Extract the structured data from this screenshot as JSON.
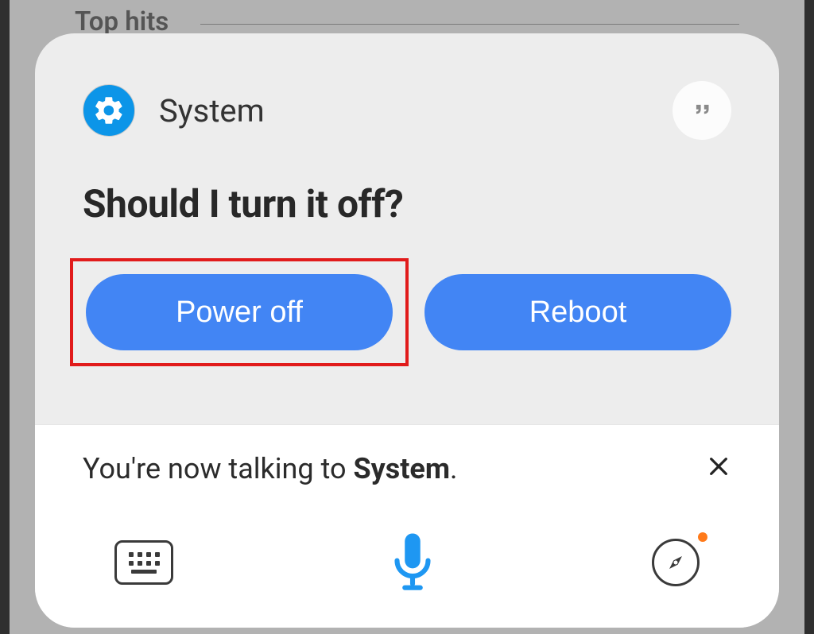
{
  "backgroundLabel": "Top hits",
  "header": {
    "systemLabel": "System"
  },
  "prompt": "Should I turn it off?",
  "buttons": {
    "powerOff": "Power off",
    "reboot": "Reboot"
  },
  "status": {
    "prefix": "You're now talking to ",
    "entity": "System",
    "suffix": "."
  },
  "colors": {
    "accent": "#4285f4",
    "highlight": "#e11b1b",
    "mic": "#1e97f2"
  }
}
